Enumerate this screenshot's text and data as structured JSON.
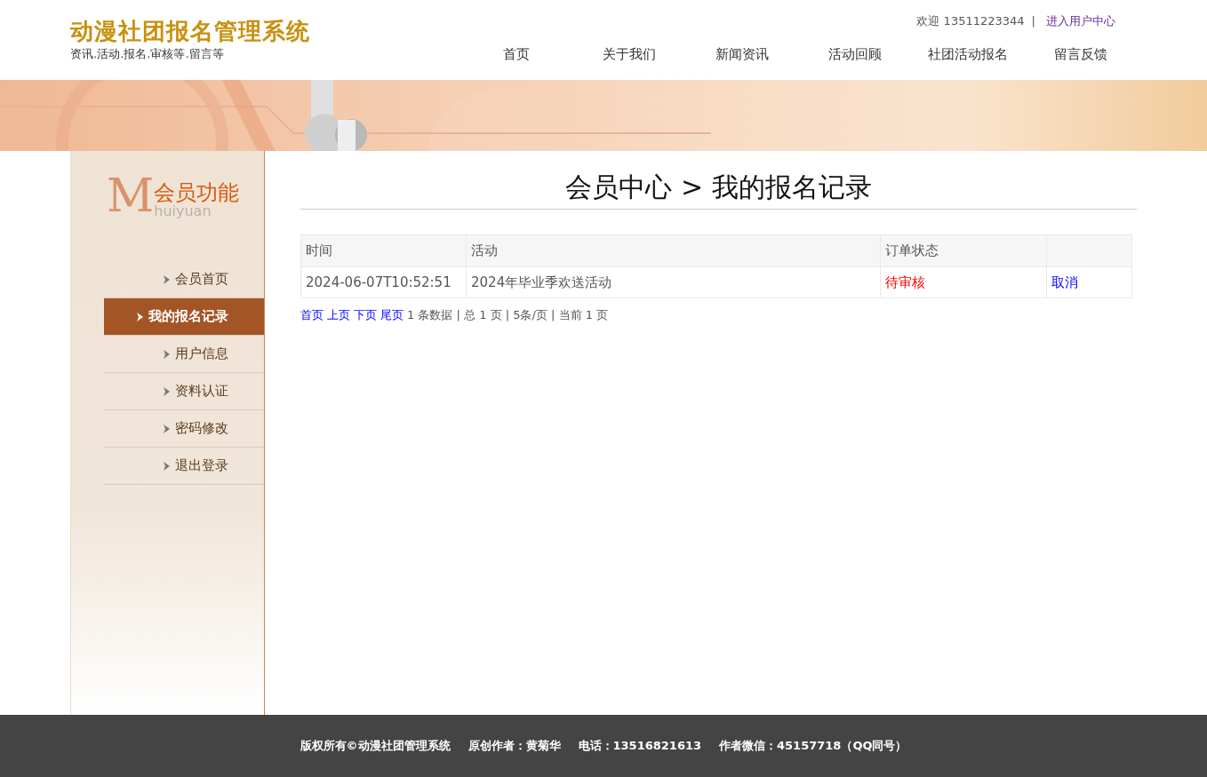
{
  "header": {
    "title": "动漫社团报名管理系统",
    "subtitle": "资讯.活动.报名.审核等.留言等",
    "welcome": "欢迎 13511223344",
    "separator": "|",
    "user_center_link": "进入用户中心"
  },
  "nav": [
    {
      "label": "首页"
    },
    {
      "label": "关于我们"
    },
    {
      "label": "新闻资讯"
    },
    {
      "label": "活动回顾"
    },
    {
      "label": "社团活动报名"
    },
    {
      "label": "留言反馈"
    }
  ],
  "sidebar": {
    "logo": {
      "letter": "M",
      "title": "会员功能",
      "subtitle": "huiyuan"
    },
    "items": [
      {
        "label": "会员首页",
        "selected": false
      },
      {
        "label": "我的报名记录",
        "selected": true
      },
      {
        "label": "用户信息",
        "selected": false
      },
      {
        "label": "资料认证",
        "selected": false
      },
      {
        "label": "密码修改",
        "selected": false
      },
      {
        "label": "退出登录",
        "selected": false
      }
    ]
  },
  "page_title": "会员中心 > 我的报名记录",
  "table": {
    "columns": [
      "时间",
      "活动",
      "订单状态"
    ],
    "rows": [
      {
        "cells": [
          "2024-06-07T10:52:51",
          "2024年毕业季欢送活动",
          "待审核"
        ],
        "action": "取消"
      }
    ]
  },
  "pagination": {
    "links": [
      "首页",
      "上页",
      "下页",
      "尾页"
    ],
    "info": "1 条数据 | 总 1 页 | 5条/页 | 当前 1 页"
  },
  "footer": [
    "版权所有©动漫社团管理系统",
    "原创作者：黄菊华",
    "电话：13516821613",
    "作者微信：45157718（QQ同号）"
  ]
}
